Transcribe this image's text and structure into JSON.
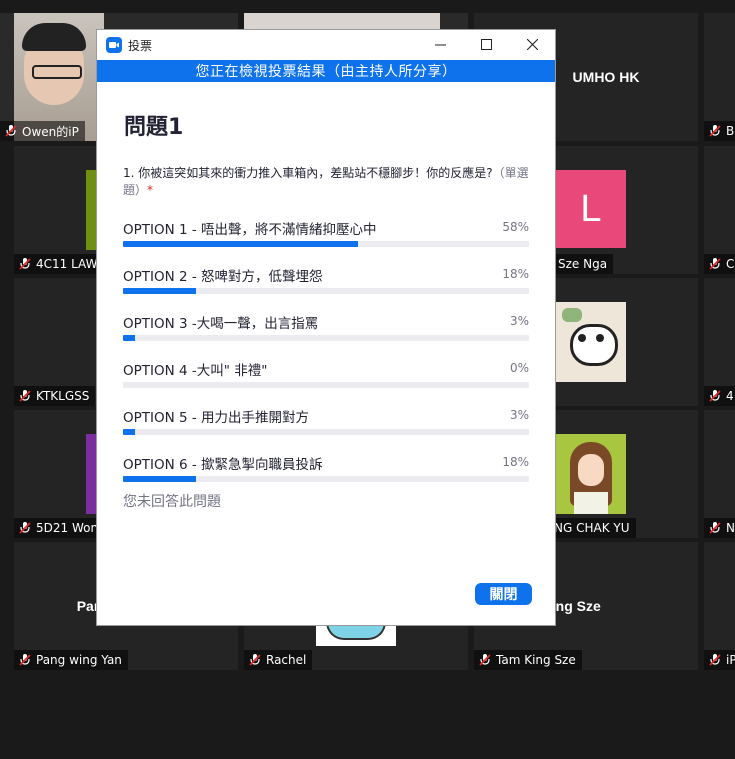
{
  "colors": {
    "accent": "#0e72ed",
    "track": "#ececf0",
    "muted_mic": "#e02828"
  },
  "tiles": {
    "owen": "Owen的iP",
    "bo": "Bo",
    "amho": "UMHO HK",
    "lawl": "4C11 LAW",
    "sze_nga": "Sze Nga",
    "c_right": "C",
    "ktklgss": "KTKLGSS",
    "four_right": "4",
    "fived21": "5D21 Won",
    "chak_yu": "NG CHAK YU",
    "n_right": "N",
    "pang_center": "Pang wing Yan",
    "pang_label": "Pang wing Yan",
    "rachel": "Rachel",
    "tam_center": "Tam King Sze",
    "tam_label": "Tam King Sze",
    "ip_right": "iP",
    "avatar_letter": "L"
  },
  "dialog": {
    "title": "投票",
    "banner": "您正在檢視投票結果（由主持人所分享）",
    "question_title": "問題1",
    "question_text": "1. 你被這突如其來的衝力推入車箱內，差點站不穩腳步！你的反應是?",
    "question_type": "（單選題）",
    "required_mark": "*",
    "not_answered": "您未回答此問題",
    "close_label": "關閉"
  },
  "options": [
    {
      "label": "OPTION 1 - 唔出聲，將不滿情緒抑壓心中",
      "pct_text": "58%",
      "percent": 58
    },
    {
      "label": "OPTION 2 - 怒啤對方，低聲埋怨",
      "pct_text": "18%",
      "percent": 18
    },
    {
      "label": "OPTION 3 -大喝一聲，出言指罵",
      "pct_text": "3%",
      "percent": 3
    },
    {
      "label": "OPTION 4 -大叫\" 非禮\"",
      "pct_text": "0%",
      "percent": 0
    },
    {
      "label": "OPTION 5 - 用力出手推開對方",
      "pct_text": "3%",
      "percent": 3
    },
    {
      "label": "OPTION 6 - 撳緊急掣向職員投訴",
      "pct_text": "18%",
      "percent": 18
    }
  ]
}
